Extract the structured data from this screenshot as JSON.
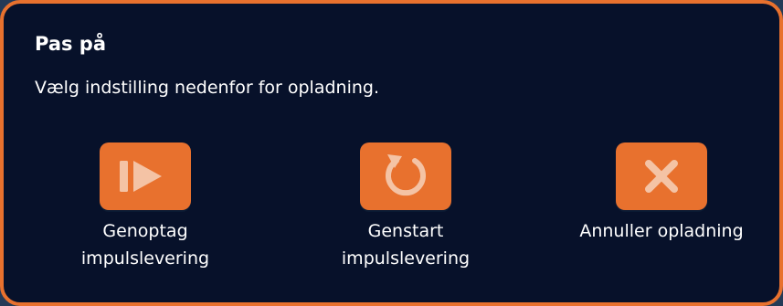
{
  "dialog": {
    "title": "Pas på",
    "message": "Vælg indstilling nedenfor for opladning.",
    "accent_color": "#e8712e",
    "background_color": "#07112a",
    "actions": [
      {
        "icon": "resume-play-icon",
        "label_line1": "Genoptag",
        "label_line2": "impulslevering"
      },
      {
        "icon": "restart-icon",
        "label_line1": "Genstart",
        "label_line2": "impulslevering"
      },
      {
        "icon": "close-x-icon",
        "label_line1": "Annuller opladning",
        "label_line2": ""
      }
    ]
  }
}
